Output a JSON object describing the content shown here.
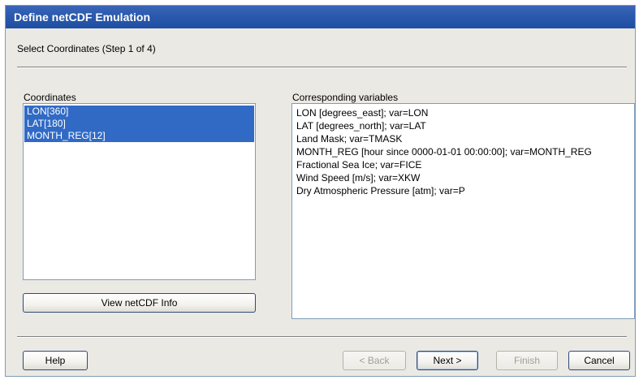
{
  "window": {
    "title": "Define netCDF Emulation",
    "step_label": "Select Coordinates (Step 1 of 4)"
  },
  "coordinates": {
    "label": "Coordinates",
    "items": [
      "LON[360]",
      "LAT[180]",
      "MONTH_REG[12]"
    ],
    "selected": [
      "LON[360]",
      "LAT[180]",
      "MONTH_REG[12]"
    ],
    "view_button": "View netCDF Info"
  },
  "variables": {
    "label": "Corresponding variables",
    "items": [
      "LON [degrees_east]; var=LON",
      "LAT [degrees_north]; var=LAT",
      "Land Mask; var=TMASK",
      "MONTH_REG [hour since 0000-01-01 00:00:00]; var=MONTH_REG",
      "Fractional Sea Ice; var=FICE",
      "Wind Speed [m/s]; var=XKW",
      "Dry Atmospheric Pressure [atm]; var=P"
    ]
  },
  "buttons": {
    "help": "Help",
    "back": "< Back",
    "next": "Next >",
    "finish": "Finish",
    "cancel": "Cancel"
  },
  "colors": {
    "titlebar": "#2a59ad",
    "selection": "#316ac5",
    "dialog_bg": "#ebe9e4"
  }
}
